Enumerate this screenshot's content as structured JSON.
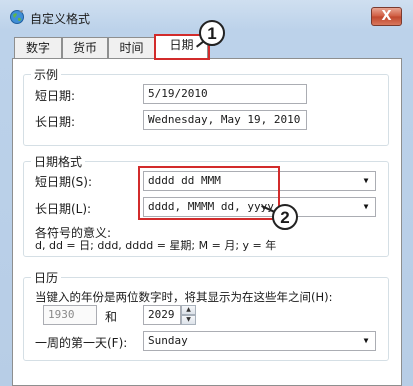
{
  "window": {
    "title": "自定义格式",
    "close_label": "X"
  },
  "tabs": [
    {
      "label": "数字"
    },
    {
      "label": "货币"
    },
    {
      "label": "时间"
    },
    {
      "label": "日期"
    }
  ],
  "active_tab": "日期",
  "examples": {
    "legend": "示例",
    "short_label": "短日期:",
    "short_value": "5/19/2010",
    "long_label": "长日期:",
    "long_value": "Wednesday, May 19, 2010"
  },
  "date_formats": {
    "legend": "日期格式",
    "short_label": "短日期(S):",
    "short_value": "dddd dd MMM",
    "long_label": "长日期(L):",
    "long_value": "dddd, MMMM dd, yyyy",
    "notation_title": "各符号的意义:",
    "notation_text": "d, dd = 日;  ddd, dddd = 星期;  M = 月;  y = 年"
  },
  "calendar": {
    "legend": "日历",
    "two_digit_text": "当键入的年份是两位数字时，将其显示为在这些年之间(H):",
    "year_from": "1930",
    "and_label": "和",
    "year_to": "2029",
    "first_day_label": "一周的第一天(F):",
    "first_day_value": "Sunday"
  },
  "callouts": [
    {
      "number": "1"
    },
    {
      "number": "2"
    }
  ],
  "colors": {
    "highlight": "#d22b2b",
    "close_button": "#c0462c"
  },
  "icons": {
    "app": "globe-icon",
    "dropdown": "chevron-down-icon"
  }
}
